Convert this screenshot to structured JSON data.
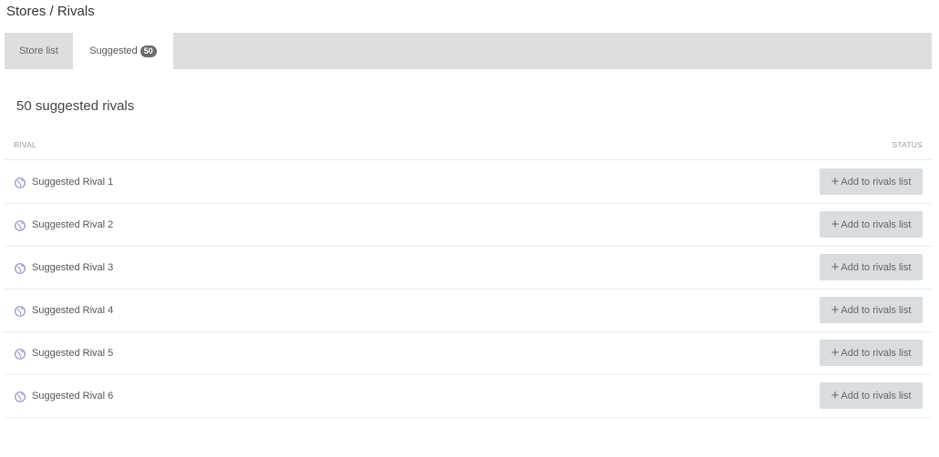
{
  "breadcrumb": "Stores / Rivals",
  "tabs": {
    "store_list": "Store list",
    "suggested": "Suggested",
    "suggested_count": "50"
  },
  "section_title": "50 suggested rivals",
  "table": {
    "col_rival": "RIVAL",
    "col_status": "STATUS"
  },
  "rows": [
    {
      "name": "Suggested Rival 1",
      "action": "Add to rivals list"
    },
    {
      "name": "Suggested Rival 2",
      "action": "Add to rivals list"
    },
    {
      "name": "Suggested Rival 3",
      "action": "Add to rivals list"
    },
    {
      "name": "Suggested Rival 4",
      "action": "Add to rivals list"
    },
    {
      "name": "Suggested Rival 5",
      "action": "Add to rivals list"
    },
    {
      "name": "Suggested Rival 6",
      "action": "Add to rivals list"
    }
  ],
  "colors": {
    "tab_bar": "#dedede",
    "badge": "#6b6b6b",
    "button": "#d9dde0",
    "globe": "#8a8fc4"
  },
  "icons": {
    "row_icon": "globe-icon",
    "button_icon": "plus-icon"
  }
}
